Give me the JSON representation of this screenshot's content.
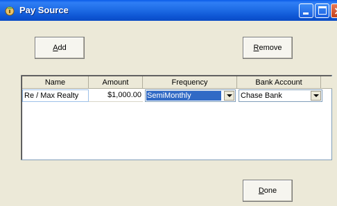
{
  "window": {
    "title": "Pay Source"
  },
  "buttons": {
    "add_label": "Add",
    "add_mnemonic": "A",
    "remove_label": "Remove",
    "remove_mnemonic": "R",
    "done_label": "Done",
    "done_mnemonic": "D"
  },
  "grid": {
    "columns": [
      "Name",
      "Amount",
      "Frequency",
      "Bank Account"
    ],
    "rows": [
      {
        "name": "Re / Max Realty",
        "amount": "$1,000.00",
        "frequency": "SemiMonthly",
        "bank_account": "Chase Bank"
      }
    ]
  },
  "icons": {
    "app_icon": "pay-source-app-icon",
    "minimize": "minimize-icon",
    "maximize": "maximize-icon",
    "close": "close-icon",
    "dropdown": "chevron-down-icon"
  },
  "colors": {
    "titlebar": "#0a5ce8",
    "selection": "#316ac5",
    "window_bg": "#ece9d8"
  }
}
